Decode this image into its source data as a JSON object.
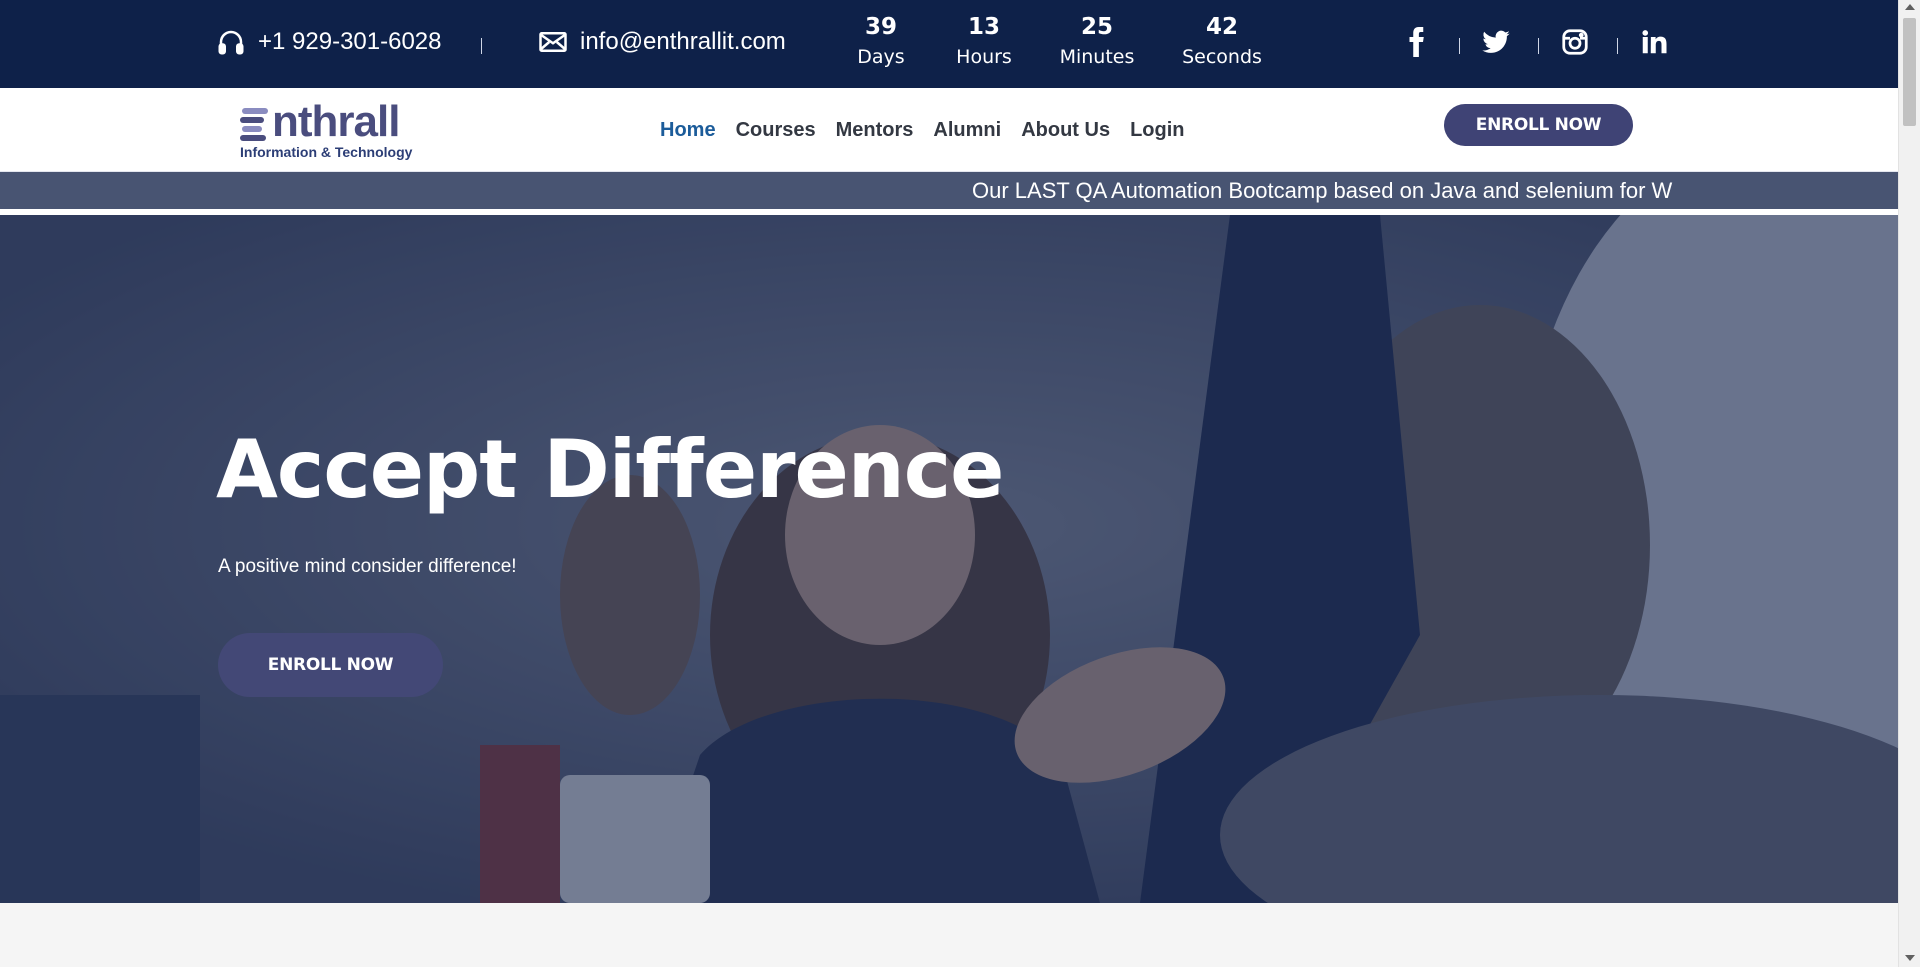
{
  "topbar": {
    "phone": "+1 929-301-6028",
    "email": "info@enthrallit.com",
    "countdown": [
      {
        "value": "39",
        "label": "Days"
      },
      {
        "value": "13",
        "label": "Hours"
      },
      {
        "value": "25",
        "label": "Minutes"
      },
      {
        "value": "42",
        "label": "Seconds"
      }
    ],
    "social_icons": [
      "facebook-icon",
      "twitter-icon",
      "instagram-icon",
      "linkedin-icon"
    ]
  },
  "brand": {
    "name": "Enthrall",
    "tagline": "Information & Technology"
  },
  "nav": {
    "items": [
      {
        "label": "Home",
        "active": true
      },
      {
        "label": "Courses"
      },
      {
        "label": "Mentors"
      },
      {
        "label": "Alumni"
      },
      {
        "label": "About Us"
      },
      {
        "label": "Login"
      }
    ],
    "enroll_label": "ENROLL NOW"
  },
  "ticker": {
    "text": "Our LAST QA Automation Bootcamp based on Java and selenium for W"
  },
  "hero": {
    "title": "Accept Difference",
    "subtitle": "A positive mind consider difference!",
    "cta_label": "ENROLL NOW"
  },
  "colors": {
    "topbar_bg": "#0e2149",
    "nav_active": "#1c5c9a",
    "button_bg": "#3f4375",
    "ticker_bg": "#485472",
    "hero_overlay": "#1a2952"
  }
}
